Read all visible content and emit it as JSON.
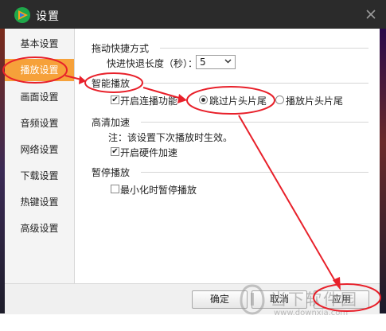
{
  "window": {
    "title": "设置"
  },
  "sidebar": {
    "items": [
      {
        "label": "基本设置"
      },
      {
        "label": "播放设置"
      },
      {
        "label": "画面设置"
      },
      {
        "label": "音频设置"
      },
      {
        "label": "网络设置"
      },
      {
        "label": "下载设置"
      },
      {
        "label": "热键设置"
      },
      {
        "label": "高级设置"
      }
    ],
    "active_index": 1
  },
  "drag_seek": {
    "title": "拖动快捷方式",
    "step_label": "快进快退长度（秒）：",
    "step_value": "5"
  },
  "smart_play": {
    "title": "智能播放",
    "continuous_label": "开启连播功能",
    "continuous_checked": true,
    "options": [
      {
        "label": "跳过片头片尾",
        "checked": true
      },
      {
        "label": "播放片头片尾",
        "checked": false
      }
    ]
  },
  "hd_accel": {
    "title": "高清加速",
    "note": "注：该设置下次播放时生效。",
    "hw_label": "开启硬件加速",
    "hw_checked": true
  },
  "pause_play": {
    "title": "暂停播放",
    "minimize_label": "最小化时暂停播放",
    "minimize_checked": false
  },
  "buttons": {
    "ok": "确定",
    "cancel": "取消",
    "apply": "应用"
  },
  "watermark": {
    "name": "当下软件园",
    "url": "www.downxia.com"
  },
  "colors": {
    "active_nav": "#f6a13a",
    "annotation": "#e8202a",
    "titlebar": "#2b2b2b"
  }
}
